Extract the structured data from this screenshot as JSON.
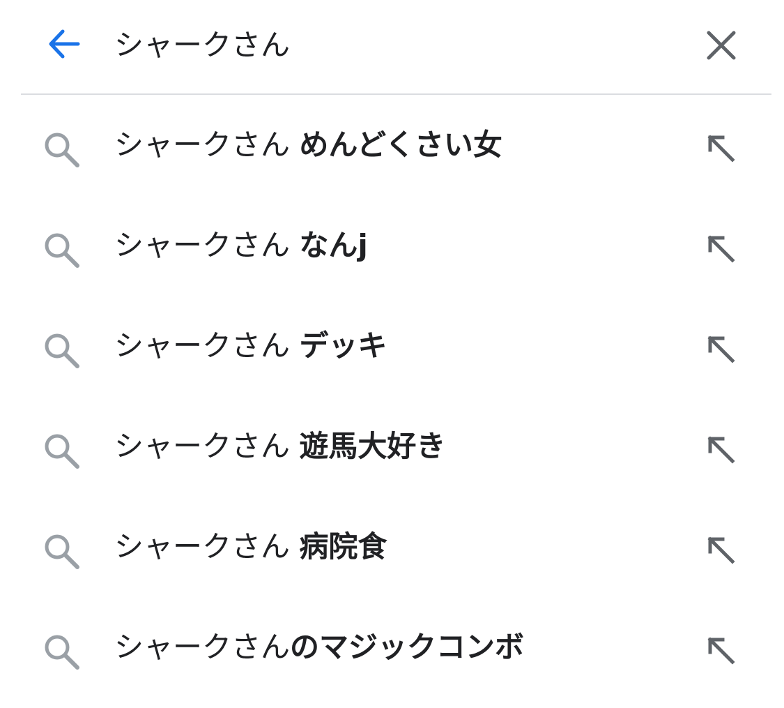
{
  "search": {
    "query": "シャークさん",
    "placeholder": ""
  },
  "icons": {
    "back": "arrow-back-icon",
    "clear": "close-icon",
    "suggestion": "search-icon",
    "fill": "arrow-up-left-icon"
  },
  "colors": {
    "accent": "#1a73e8",
    "icon_gray": "#5f6368",
    "search_icon_gray": "#9aa0a6",
    "text": "#202124",
    "divider": "#dadce0"
  },
  "suggestions": [
    {
      "prefix": "シャークさん ",
      "completion": "めんどくさい女"
    },
    {
      "prefix": "シャークさん ",
      "completion": "なんj"
    },
    {
      "prefix": "シャークさん ",
      "completion": "デッキ"
    },
    {
      "prefix": "シャークさん ",
      "completion": "遊馬大好き"
    },
    {
      "prefix": "シャークさん ",
      "completion": "病院食"
    },
    {
      "prefix": "シャークさん",
      "completion": "のマジックコンボ"
    }
  ]
}
